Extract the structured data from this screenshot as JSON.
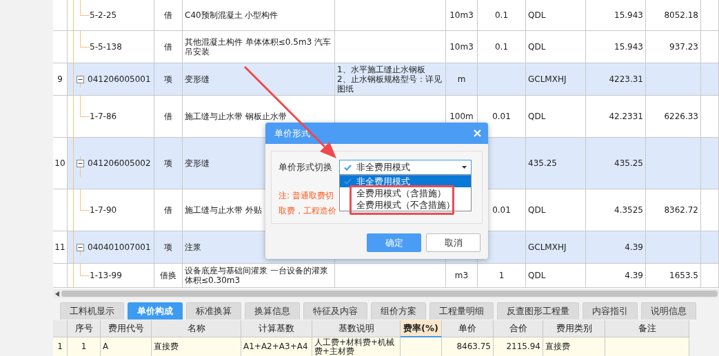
{
  "grid": {
    "rows": [
      {
        "kind": "sub",
        "code": "5-2-25",
        "type": "借",
        "name": "C40预制混凝土 小型构件",
        "unit": "10m3",
        "qty": "0.1",
        "expr": "QDL",
        "amount": "15.943",
        "total": "8052.18"
      },
      {
        "kind": "sub",
        "code": "5-5-138",
        "type": "借",
        "name": "其他混凝土构件 单体体积≤0.5m3 汽车吊安装",
        "unit": "10m3",
        "qty": "0.1",
        "expr": "QDL",
        "amount": "15.943",
        "total": "937.23"
      },
      {
        "kind": "item",
        "expanded": true,
        "seq": "9",
        "code": "041206005001",
        "type": "项",
        "name": "变形缝",
        "feature": "1、水平施工缝止水钢板\n2、止水钢板规格型号：详见图纸",
        "unit": "m",
        "expr": "GCLMXHJ",
        "amount": "4223.31"
      },
      {
        "kind": "sub",
        "code": "1-7-86",
        "type": "借",
        "name": "施工缝与止水带 钢板止水带",
        "unit": "100m",
        "qty": "0.01",
        "expr": "QDL",
        "amount": "42.2331",
        "total": "6226.33"
      },
      {
        "kind": "item",
        "expanded": true,
        "seq": "10",
        "code": "041206005002",
        "type": "项",
        "name": "变形缝",
        "expr": "435.25",
        "amount": "435.25"
      },
      {
        "kind": "sub",
        "code": "1-7-90",
        "type": "借",
        "name": "施工缝与止水带 外贴",
        "qty": "0.01",
        "expr": "QDL",
        "amount": "4.3525",
        "total": "8362.72"
      },
      {
        "kind": "item",
        "expanded": true,
        "seq": "11",
        "code": "040401007001",
        "type": "项",
        "name": "注浆",
        "expr": "GCLMXHJ",
        "amount": "4.39"
      },
      {
        "kind": "sub",
        "code": "1-13-99",
        "type": "借换",
        "name": "设备底座与基础间灌浆 一台设备的灌浆体积≤0.30m3",
        "unit": "m3",
        "qty": "1",
        "expr": "QDL",
        "amount": "4.39",
        "total": "1653.5"
      }
    ]
  },
  "tabs": [
    {
      "label": "工料机显示",
      "selected": false
    },
    {
      "label": "单价构成",
      "selected": true
    },
    {
      "label": "标准换算",
      "selected": false
    },
    {
      "label": "换算信息",
      "selected": false
    },
    {
      "label": "特征及内容",
      "selected": false
    },
    {
      "label": "组价方案",
      "selected": false
    },
    {
      "label": "工程量明细",
      "selected": false
    },
    {
      "label": "反查图形工程量",
      "selected": false
    },
    {
      "label": "内容指引",
      "selected": false
    },
    {
      "label": "说明信息",
      "selected": false
    }
  ],
  "fee_table": {
    "columns": [
      {
        "label": "序号",
        "highlighted": false
      },
      {
        "label": "费用代号",
        "highlighted": false
      },
      {
        "label": "名称",
        "highlighted": false
      },
      {
        "label": "计算基数",
        "highlighted": false
      },
      {
        "label": "基数说明",
        "highlighted": false
      },
      {
        "label": "费率(%)",
        "highlighted": true
      },
      {
        "label": "单价",
        "highlighted": false
      },
      {
        "label": "合价",
        "highlighted": false
      },
      {
        "label": "费用类别",
        "highlighted": false
      },
      {
        "label": "备注",
        "highlighted": false
      }
    ],
    "rows": [
      {
        "row_number": "1",
        "cells": [
          "1",
          "A",
          "直接费",
          "A1+A2+A3+A4",
          "人工费+材料费+机械费+主材费",
          "",
          "8463.75",
          "2115.94",
          "直接费",
          ""
        ]
      }
    ]
  },
  "dialog": {
    "title": "单价形式",
    "field_label": "单价形式切换",
    "select": {
      "value": "非全费用模式",
      "open": true
    },
    "options": [
      {
        "label": "非全费用模式",
        "selected": true
      },
      {
        "label": "全费用模式（含措施）",
        "selected": false
      },
      {
        "label": "全费用模式（不含措施）",
        "selected": false
      }
    ],
    "note": [
      "注: 普通取费切",
      "取费，工程造价"
    ],
    "buttons": [
      {
        "label": "确定",
        "kind": "primary"
      },
      {
        "label": "取消",
        "kind": "secondary"
      }
    ]
  }
}
